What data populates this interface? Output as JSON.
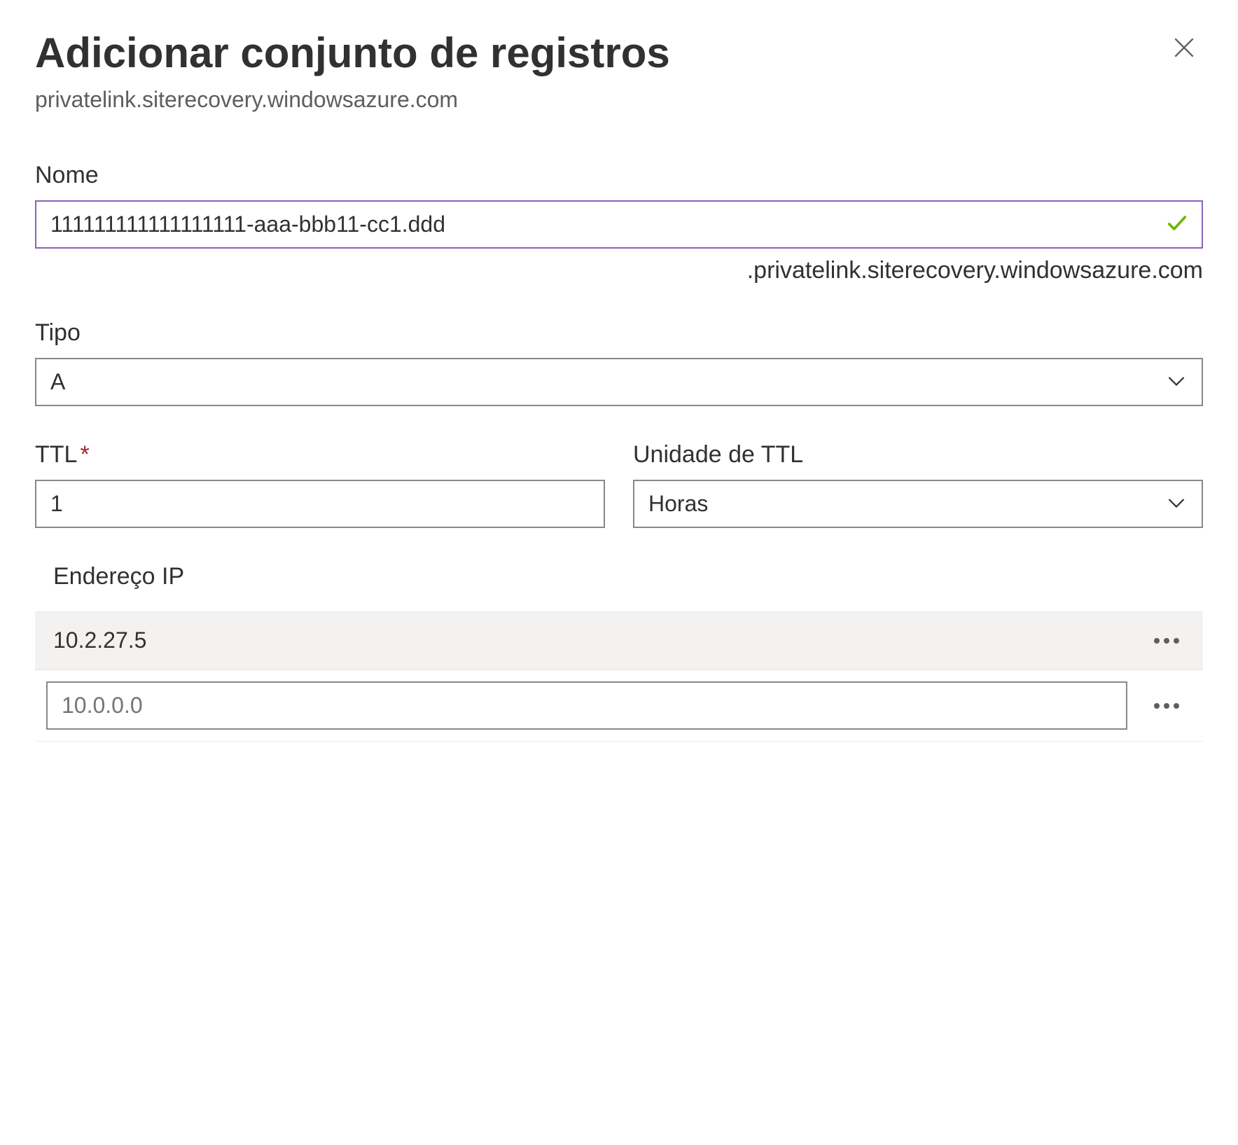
{
  "header": {
    "title": "Adicionar conjunto de registros",
    "subtitle": "privatelink.siterecovery.windowsazure.com"
  },
  "name": {
    "label": "Nome",
    "value": "111111111111111111-aaa-bbb11-cc1.ddd",
    "suffix": ".privatelink.siterecovery.windowsazure.com"
  },
  "type": {
    "label": "Tipo",
    "value": "A"
  },
  "ttl": {
    "label": "TTL",
    "value": "1"
  },
  "ttl_unit": {
    "label": "Unidade de TTL",
    "value": "Horas"
  },
  "ip": {
    "label": "Endereço IP",
    "filled_value": "10.2.27.5",
    "placeholder_value": "10.0.0.0"
  }
}
